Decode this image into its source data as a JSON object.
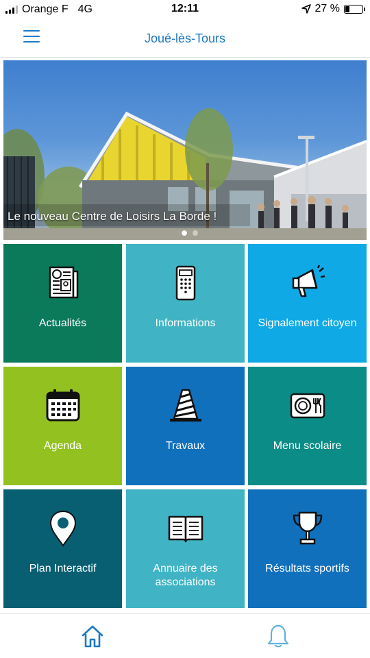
{
  "status_bar": {
    "carrier": "Orange F",
    "network": "4G",
    "time": "12:11",
    "battery_percent": "27 %",
    "battery_level": 0.27
  },
  "header": {
    "title": "Joué-lès-Tours"
  },
  "hero": {
    "caption": "Le nouveau Centre de Loisirs La Borde !",
    "active_slide": 1,
    "slide_count": 2
  },
  "tiles": [
    {
      "label": "Actualités",
      "color": "#0a7a5a",
      "icon": "newspaper-icon"
    },
    {
      "label": "Informations",
      "color": "#40b4c4",
      "icon": "phone-keypad-icon"
    },
    {
      "label": "Signalement citoyen",
      "color": "#0fa9e6",
      "icon": "megaphone-icon"
    },
    {
      "label": "Agenda",
      "color": "#93c11f",
      "icon": "calendar-icon"
    },
    {
      "label": "Travaux",
      "color": "#1170bc",
      "icon": "traffic-cone-icon"
    },
    {
      "label": "Menu scolaire",
      "color": "#0b8c86",
      "icon": "plate-cutlery-icon"
    },
    {
      "label": "Plan Interactif",
      "color": "#085f72",
      "icon": "map-pin-icon"
    },
    {
      "label": "Annuaire des associations",
      "color": "#40b4c4",
      "icon": "open-book-icon"
    },
    {
      "label": "Résultats sportifs",
      "color": "#1170bc",
      "icon": "trophy-icon"
    }
  ],
  "bottom_nav": {
    "items": [
      {
        "name": "home",
        "icon": "home-icon",
        "color": "#1b78c4"
      },
      {
        "name": "notifications",
        "icon": "bell-icon",
        "color": "#5fb3dc"
      }
    ]
  }
}
